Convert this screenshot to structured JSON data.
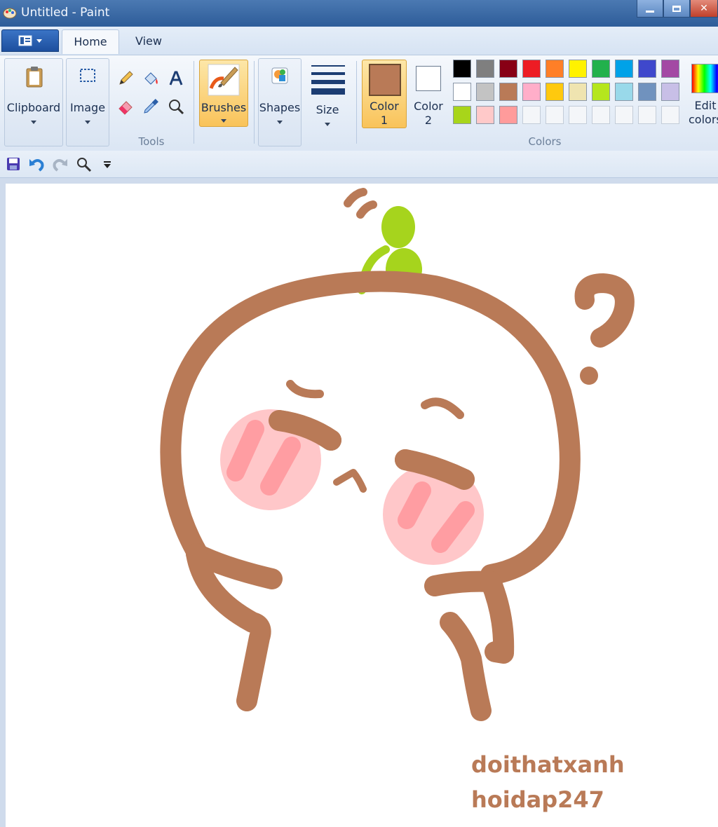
{
  "window": {
    "title": "Untitled - Paint"
  },
  "tabs": [
    {
      "label": "Home"
    },
    {
      "label": "View"
    }
  ],
  "ribbon": {
    "clipboard": {
      "label": "Clipboard"
    },
    "image": {
      "label": "Image"
    },
    "tools": {
      "group_label": "Tools"
    },
    "brushes": {
      "label": "Brushes"
    },
    "shapes": {
      "label": "Shapes"
    },
    "size": {
      "label": "Size"
    },
    "color1": {
      "label_line1": "Color",
      "label_line2": "1",
      "value": "#b97a57"
    },
    "color2": {
      "label_line1": "Color",
      "label_line2": "2",
      "value": "#ffffff"
    },
    "colors": {
      "group_label": "Colors",
      "palette_row1": [
        "#000000",
        "#7f7f7f",
        "#880015",
        "#ed1c24",
        "#ff7f27",
        "#fff200",
        "#22b14c",
        "#00a2e8",
        "#3f48cc",
        "#a349a4"
      ],
      "palette_row2": [
        "#ffffff",
        "#c3c3c3",
        "#b97a57",
        "#ffaec9",
        "#ffc90e",
        "#efe4b0",
        "#b5e61d",
        "#99d9ea",
        "#7092be",
        "#c8bfe7"
      ],
      "palette_row3": [
        "#a8d51a",
        "#ffc9c9",
        "#ff9b9b",
        "",
        "",
        "",
        "",
        "",
        "",
        ""
      ]
    },
    "edit_colors": {
      "label_line1": "Edit",
      "label_line2": "colors"
    }
  },
  "drawing": {
    "stroke_color": "#b97a57",
    "sprout_color": "#a6d41d",
    "blush_color": "#ffc7c9",
    "blush_stripe_color": "#ff9da2"
  },
  "watermark": {
    "line1": "doithatxanh",
    "line2": "hoidap247"
  }
}
